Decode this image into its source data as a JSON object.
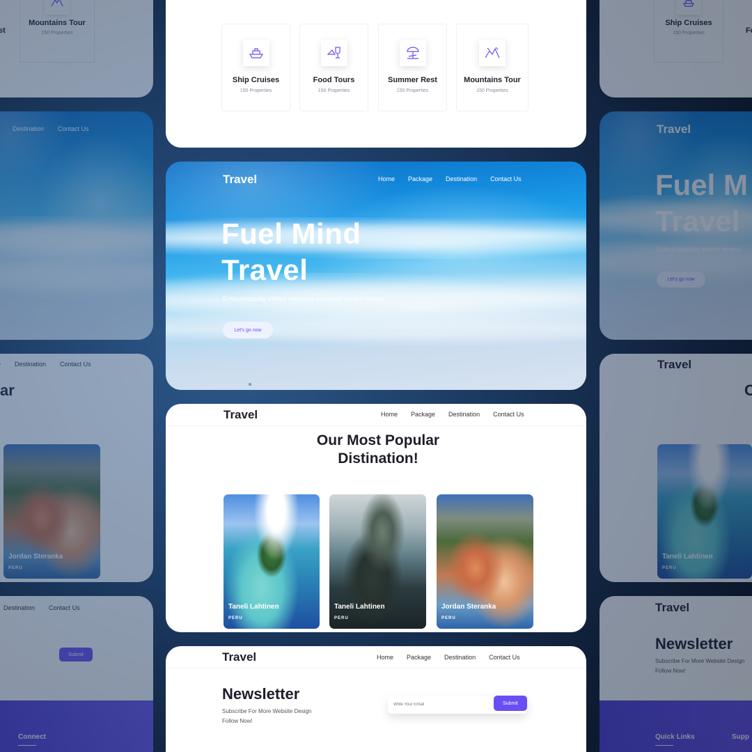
{
  "brand": {
    "logo": "Travel",
    "accent": "#6b4ef3"
  },
  "nav": {
    "home": "Home",
    "package": "Package",
    "destination": "Destination",
    "contact": "Contact Us"
  },
  "categories": {
    "items": [
      {
        "title": "Ship Cruises",
        "count": "150 Properties",
        "icon": "ship-icon"
      },
      {
        "title": "Food Tours",
        "count": "150 Properties",
        "icon": "wine-glass-icon"
      },
      {
        "title": "Summer Rest",
        "count": "150 Properties",
        "icon": "beach-umbrella-icon"
      },
      {
        "title": "Mountains Tour",
        "count": "150 Properties",
        "icon": "mountain-icon"
      }
    ]
  },
  "hero": {
    "title_line1": "Fuel Mind",
    "title_line2": "Travel",
    "subtitle": "Enthusiastically extend extensive customer service before",
    "cta": "Let's go now"
  },
  "popular": {
    "title_line1": "Our Most Popular",
    "title_line2": "Distination!",
    "cards": [
      {
        "name": "Taneli Lahtinen",
        "country": "PERU"
      },
      {
        "name": "Taneli Lahtinen",
        "country": "PERU"
      },
      {
        "name": "Jordan Steranka",
        "country": "PERU"
      }
    ]
  },
  "newsletter": {
    "title": "Newsletter",
    "text_line1": "Subscribe For More Website Design",
    "text_line2": "Follow Now!",
    "placeholder": "Write Your Email",
    "submit": "Submit"
  },
  "footer": {
    "connect": "Connect",
    "quick_links": "Quick Links",
    "support": "Supp"
  },
  "side": {
    "truncated_st": "st",
    "truncated_ar": "ar",
    "truncated_e": "e",
    "truncated_fo": "Fo",
    "hero_cut_1": "Fuel M",
    "hero_cut_2": "Travel",
    "hero_cut_sub": "Enthusiastically extend extens",
    "popular_cut": "O",
    "newsletter_cut_text": "Subscribe For More Website Design",
    "card_name_left": "Jordan Steranka",
    "card_name_right": "Taneli Lahtinen"
  }
}
